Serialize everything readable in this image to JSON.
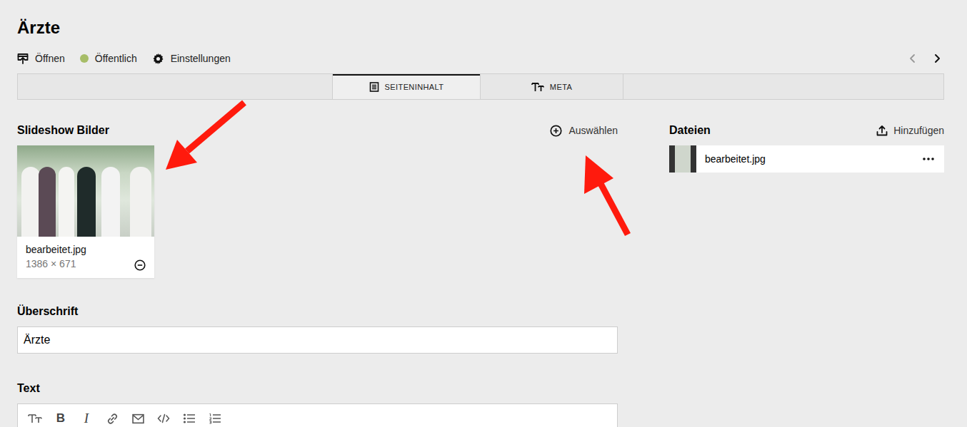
{
  "page": {
    "title": "Ärzte"
  },
  "toolbar": [
    {
      "label": "Öffnen"
    },
    {
      "label": "Öffentlich"
    },
    {
      "label": "Einstellungen"
    }
  ],
  "pager": {
    "prev_disabled": true,
    "next_disabled": false
  },
  "tabs": [
    {
      "label": "",
      "selected": false
    },
    {
      "label": "SEITENINHALT",
      "selected": true
    },
    {
      "label": "META",
      "selected": false
    }
  ],
  "slideshow": {
    "title": "Slideshow Bilder",
    "action": "Auswählen",
    "images": [
      {
        "filename": "bearbeitet.jpg",
        "dimensions": "1386 × 671"
      }
    ]
  },
  "files": {
    "title": "Dateien",
    "action": "Hinzufügen",
    "items": [
      {
        "filename": "bearbeitet.jpg"
      }
    ]
  },
  "heading_field": {
    "label": "Überschrift",
    "value": "Ärzte"
  },
  "text_field": {
    "label": "Text",
    "toolbar": [
      {
        "kind": "icon"
      },
      {
        "kind": "text",
        "label": "B"
      },
      {
        "kind": "text",
        "label": "I"
      },
      {
        "kind": "icon"
      },
      {
        "kind": "icon"
      },
      {
        "kind": "icon"
      },
      {
        "kind": "icon"
      },
      {
        "kind": "icon"
      }
    ]
  }
}
